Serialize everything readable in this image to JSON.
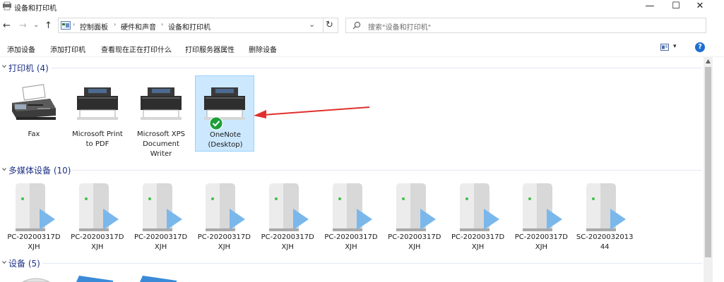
{
  "window": {
    "title": "设备和打印机",
    "minimize": "—",
    "maximize": "☐",
    "close": "✕"
  },
  "nav": {
    "back": "←",
    "forward": "→",
    "dropdown": "⌄",
    "up": "↑",
    "refresh": "↻",
    "address_dropdown": "⌄"
  },
  "breadcrumb": {
    "items": [
      "控制面板",
      "硬件和声音",
      "设备和打印机"
    ],
    "sep": "›"
  },
  "search": {
    "placeholder": "搜索\"设备和打印机\""
  },
  "toolbar": {
    "items": [
      "添加设备",
      "添加打印机",
      "查看现在正在打印什么",
      "打印服务器属性",
      "删除设备"
    ],
    "view_dropdown": "▾",
    "help": "?"
  },
  "groups": {
    "printers": {
      "header": "打印机 (4)",
      "items": [
        {
          "label": "Fax",
          "icon": "fax-icon"
        },
        {
          "label": "Microsoft Print\nto PDF",
          "icon": "printer-icon"
        },
        {
          "label": "Microsoft XPS\nDocument\nWriter",
          "icon": "printer-icon"
        },
        {
          "label": "OneNote\n(Desktop)",
          "icon": "printer-icon",
          "default": true,
          "selected": true
        }
      ]
    },
    "multimedia": {
      "header": "多媒体设备 (10)",
      "items": [
        {
          "label": "PC-20200317D\nXJH"
        },
        {
          "label": "PC-20200317D\nXJH"
        },
        {
          "label": "PC-20200317D\nXJH"
        },
        {
          "label": "PC-20200317D\nXJH"
        },
        {
          "label": "PC-20200317D\nXJH"
        },
        {
          "label": "PC-20200317D\nXJH"
        },
        {
          "label": "PC-20200317D\nXJH"
        },
        {
          "label": "PC-20200317D\nXJH"
        },
        {
          "label": "PC-20200317D\nXJH"
        },
        {
          "label": "SC-2020032013\n44"
        }
      ]
    },
    "devices": {
      "header": "设备 (5)"
    }
  },
  "colors": {
    "accent": "#1e3287",
    "selection": "#cce8ff",
    "arrow": "#e0302c",
    "help": "#1e6fd0"
  }
}
